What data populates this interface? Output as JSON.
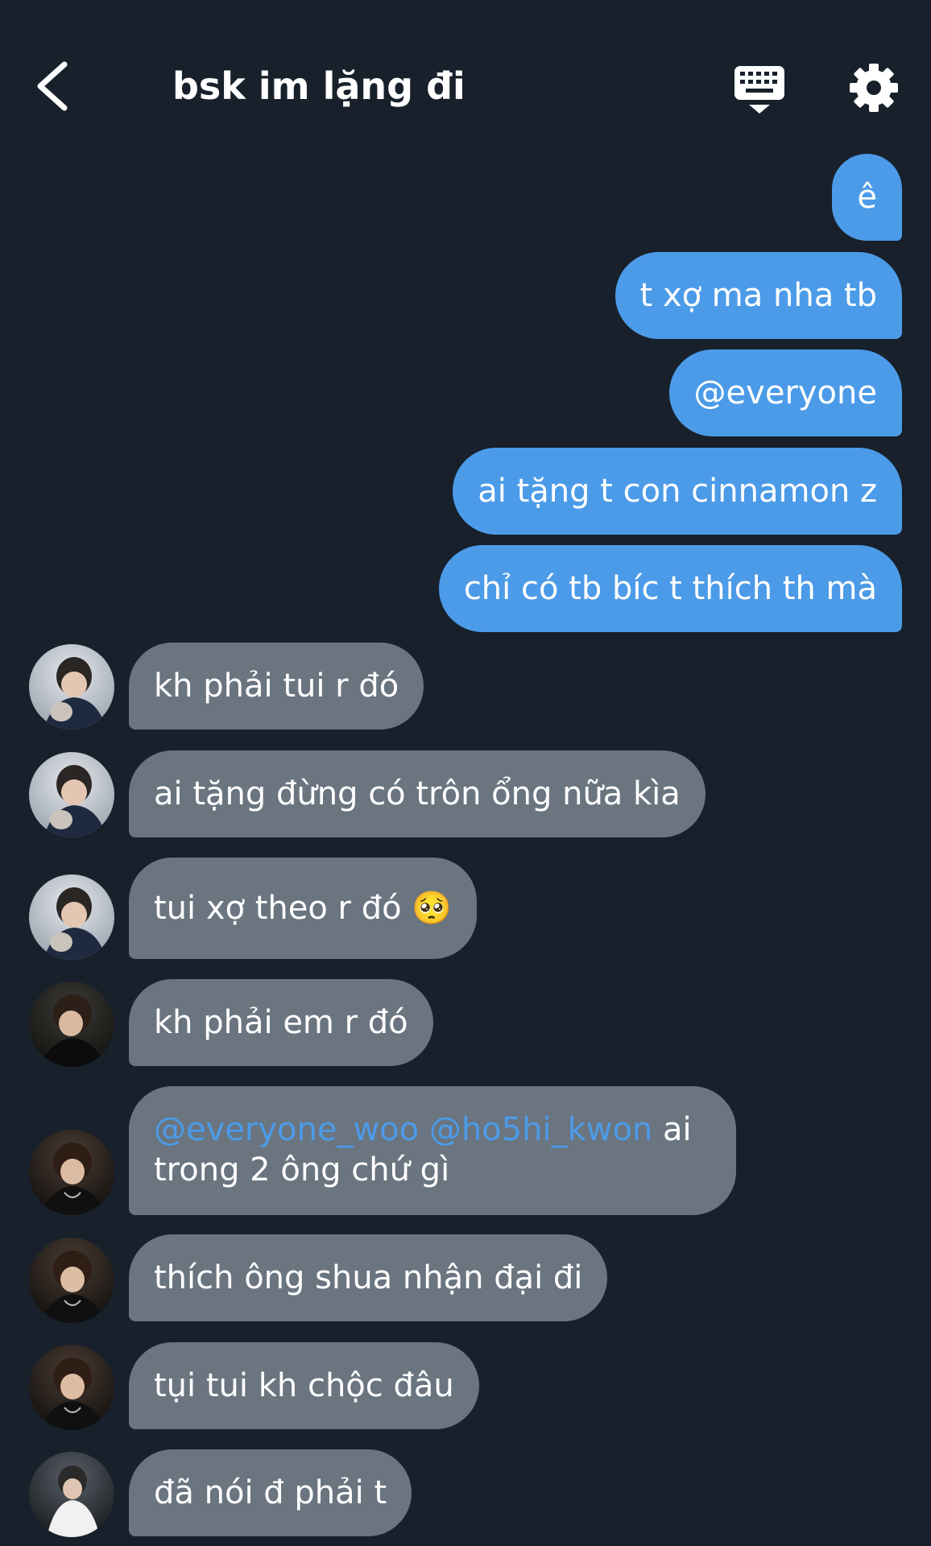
{
  "header": {
    "title": "bsk im lặng đi",
    "back_icon": "chevron-left-icon",
    "keyboard_icon": "keyboard-icon",
    "settings_icon": "gear-icon"
  },
  "colors": {
    "background": "#17202b",
    "outgoing_bubble": "#4c9be8",
    "incoming_bubble": "#6a7580",
    "mention": "#4c9be8"
  },
  "outgoing": [
    {
      "text": "ê"
    },
    {
      "text": "t xợ ma nha tb"
    },
    {
      "text": "@everyone"
    },
    {
      "text": "ai tặng t con cinnamon z"
    },
    {
      "text": "chỉ có tb bíc t thích th mà"
    }
  ],
  "incoming": [
    {
      "text": "kh phải tui r đó",
      "sender": "a"
    },
    {
      "text": "ai tặng đừng có trôn ổng nữa kìa",
      "sender": "a"
    },
    {
      "text": "tui xợ theo r đó",
      "emoji": "🥺",
      "sender": "a"
    },
    {
      "text": "kh phải em r đó",
      "sender": "b"
    },
    {
      "mention1": "@everyone_woo",
      "mention2": "@ho5hi_kwon",
      "text_line1": " ai",
      "text_line2": "trong 2 ông chứ gì",
      "sender": "c"
    },
    {
      "text": "thích ông shua nhận đại đi",
      "sender": "c"
    },
    {
      "text": "tụi tui kh chộc đâu",
      "sender": "c"
    },
    {
      "text": "đã nói đ phải t",
      "sender": "d"
    }
  ]
}
